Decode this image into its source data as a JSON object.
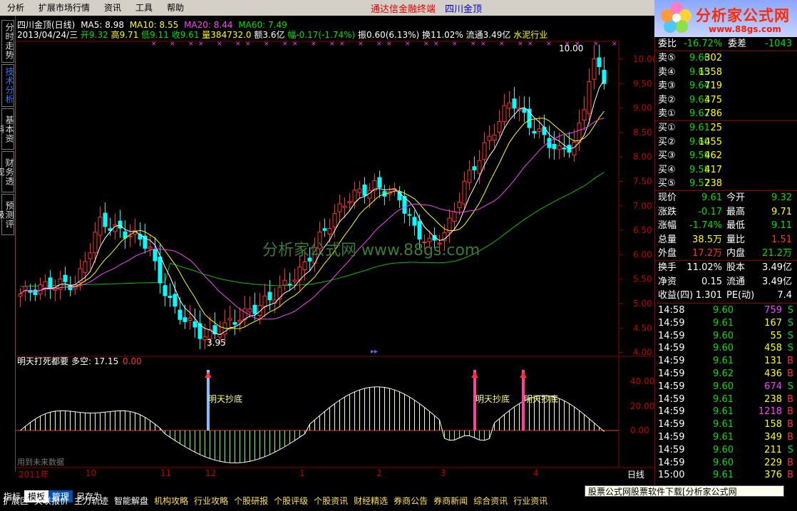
{
  "menu": {
    "items": [
      "分析",
      "扩展市场行情",
      "资讯",
      "工具",
      "帮助"
    ],
    "brand": "通达信金融终端",
    "stock_name": "四川金顶"
  },
  "logo": {
    "title": "分析家公式网",
    "url": "www.88gs.com"
  },
  "side_tabs": [
    "分时走势",
    "技术分析",
    "基本资料",
    "财务透视",
    "预测评级"
  ],
  "main_header": {
    "title": "四川金顶(日线)",
    "ma5": "MA5: 8.98",
    "ma10": "MA10: 8.55",
    "ma20": "MA20: 8.44",
    "ma60": "MA60: 7.49",
    "date": "2013/04/24/三",
    "open": "开9.32",
    "high": "高9.71",
    "low": "低9.11",
    "close": "收9.61",
    "volume": "量384732.0",
    "amount": "额3.6亿",
    "change": "幅-0.17(-1.74%)",
    "amplitude": "振0.60(6.13%)",
    "turnover": "换11.02%",
    "float": "流通3.49亿",
    "industry": "水泥行业"
  },
  "price_axis": [
    "10.00",
    "9.50",
    "9.00",
    "8.50",
    "8.00",
    "7.50",
    "7.00",
    "6.50",
    "6.00",
    "5.50",
    "5.00",
    "4.50",
    "4.00"
  ],
  "annotations": {
    "high_label": "10.00",
    "low_label": "3.95",
    "watermark": "分析家公式网  www.88gs.com"
  },
  "indicator": {
    "title": "明天打死都要",
    "value_label": "多空: 17.15",
    "value2": "0.00",
    "signal_label": "明天抄底",
    "axis": [
      "40.00",
      "20.00",
      "0.00"
    ],
    "future_note": "用到未来数据"
  },
  "time_axis": [
    "2011年",
    "10",
    "11",
    "12",
    "1",
    "2",
    "3",
    "4"
  ],
  "period_label": "日线",
  "quote": {
    "wei": {
      "left_label": "委比",
      "left_value": "-16.72%",
      "right_label": "委差",
      "right_value": "-1043"
    },
    "asks": [
      {
        "label": "卖⑤",
        "price": "9.66",
        "vol": "302"
      },
      {
        "label": "卖④",
        "price": "9.65",
        "vol": "1358"
      },
      {
        "label": "卖③",
        "price": "9.64",
        "vol": "719"
      },
      {
        "label": "卖②",
        "price": "9.63",
        "vol": "475"
      },
      {
        "label": "卖①",
        "price": "9.62",
        "vol": "786"
      }
    ],
    "bids": [
      {
        "label": "买①",
        "price": "9.61",
        "vol": "25"
      },
      {
        "label": "买②",
        "price": "9.60",
        "vol": "1455"
      },
      {
        "label": "买③",
        "price": "9.59",
        "vol": "462"
      },
      {
        "label": "买④",
        "price": "9.58",
        "vol": "417"
      },
      {
        "label": "买⑤",
        "price": "9.57",
        "vol": "238"
      }
    ],
    "stats1": [
      {
        "l1": "现价",
        "v1": "9.61",
        "c1": "#00e000",
        "l2": "今开",
        "v2": "9.32",
        "c2": "#00e000"
      },
      {
        "l1": "涨跌",
        "v1": "-0.17",
        "c1": "#00e000",
        "l2": "最高",
        "v2": "9.71",
        "c2": "#ffff00"
      },
      {
        "l1": "涨幅",
        "v1": "-1.74%",
        "c1": "#00e000",
        "l2": "最低",
        "v2": "9.11",
        "c2": "#00e000"
      },
      {
        "l1": "总量",
        "v1": "38.5万",
        "c1": "#ffff00",
        "l2": "量比",
        "v2": "1.51",
        "c2": "#ff3030"
      },
      {
        "l1": "外盘",
        "v1": "17.2万",
        "c1": "#ff3030",
        "l2": "内盘",
        "v2": "21.2万",
        "c2": "#00e000"
      }
    ],
    "stats2": [
      {
        "l1": "换手",
        "v1": "11.02%",
        "l2": "股本",
        "v2": "3.49亿"
      },
      {
        "l1": "净资",
        "v1": "0.15",
        "l2": "流通",
        "v2": "3.49亿"
      },
      {
        "l1": "收益(四)",
        "v1": "1.301",
        "l2": "PE(动)",
        "v2": "7.4"
      }
    ],
    "ticks": [
      {
        "time": "14:58",
        "price": "9.60",
        "vol": "759",
        "side": "S",
        "vc": "#ff40ff"
      },
      {
        "time": "14:59",
        "price": "9.61",
        "vol": "167",
        "side": "S",
        "vc": "#ffff00"
      },
      {
        "time": "14:59",
        "price": "9.60",
        "vol": "55",
        "side": "S",
        "vc": "#ffff00"
      },
      {
        "time": "14:59",
        "price": "9.60",
        "vol": "458",
        "side": "S",
        "vc": "#ffff00"
      },
      {
        "time": "14:59",
        "price": "9.61",
        "vol": "131",
        "side": "B",
        "vc": "#ffff00"
      },
      {
        "time": "14:59",
        "price": "9.62",
        "vol": "436",
        "side": "B",
        "vc": "#ffff00"
      },
      {
        "time": "14:59",
        "price": "9.60",
        "vol": "674",
        "side": "S",
        "vc": "#ff40ff"
      },
      {
        "time": "14:59",
        "price": "9.61",
        "vol": "238",
        "side": "B",
        "vc": "#ffff00"
      },
      {
        "time": "14:59",
        "price": "9.61",
        "vol": "1218",
        "side": "B",
        "vc": "#ff40ff"
      },
      {
        "time": "14:59",
        "price": "9.61",
        "vol": "158",
        "side": "B",
        "vc": "#ffff00"
      },
      {
        "time": "14:59",
        "price": "9.61",
        "vol": "349",
        "side": "B",
        "vc": "#ffff00"
      },
      {
        "time": "14:59",
        "price": "9.60",
        "vol": "211",
        "side": "S",
        "vc": "#ffff00"
      },
      {
        "time": "14:59",
        "price": "9.60",
        "vol": "229",
        "side": "B",
        "vc": "#ffff00"
      },
      {
        "time": "15:00",
        "price": "9.61",
        "vol": "376",
        "side": "B",
        "vc": "#ffff00"
      }
    ]
  },
  "bottom_tabs": [
    "指标",
    "模板",
    "管理",
    "另存为"
  ],
  "taskbar": [
    "扩展区",
    "关联报价",
    "主力轨迹",
    "智能解盘",
    "机构攻略",
    "行业攻略",
    "个股研报",
    "个股评级",
    "个股资讯",
    "财经精选",
    "券商公告",
    "券商新闻",
    "综合资讯",
    "行业资讯"
  ],
  "download_banner": "股票公式网股票软件下载[分析家公式网www.88gs.com]",
  "colors": {
    "up": "#ff3030",
    "down": "#00ffff",
    "ma5": "#ffffff",
    "ma10": "#ffff00",
    "ma20": "#ff40ff",
    "ma60": "#00c000",
    "grid": "#8a0000"
  }
}
